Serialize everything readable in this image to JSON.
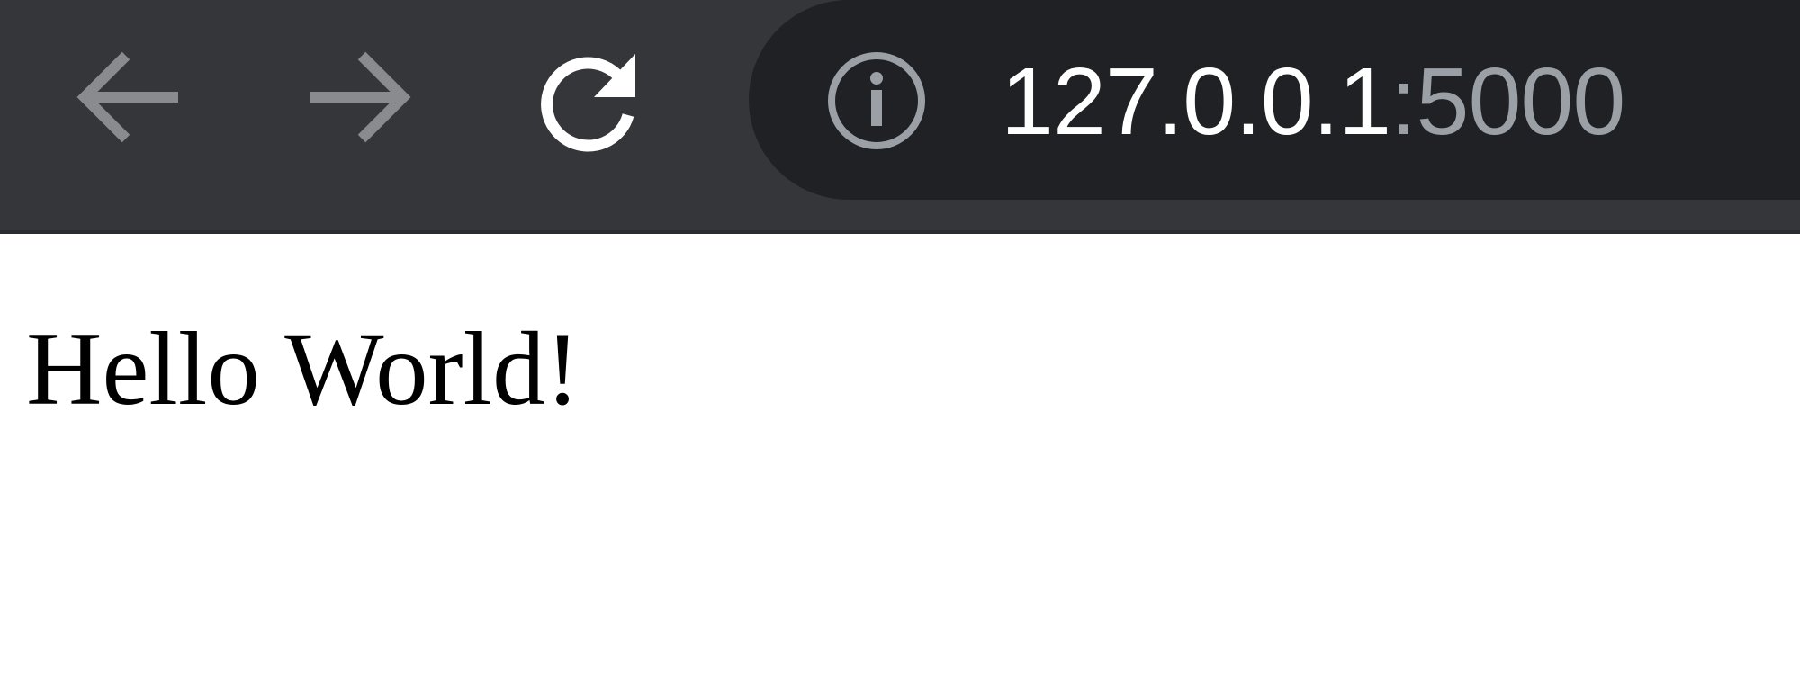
{
  "browser": {
    "toolbar": {
      "back_icon": "arrow-left-icon",
      "forward_icon": "arrow-right-icon",
      "reload_icon": "reload-icon"
    },
    "omnibox": {
      "security_icon": "info-icon",
      "url_host": "127.0.0.1",
      "url_port": ":5000"
    }
  },
  "page": {
    "text": "Hello World!"
  },
  "colors": {
    "toolbar_bg": "#35363a",
    "omnibox_bg": "#202124",
    "url_host": "#ffffff",
    "url_port": "#9aa0a6",
    "disabled_icon": "#8a8b8e",
    "enabled_icon": "#ffffff"
  }
}
